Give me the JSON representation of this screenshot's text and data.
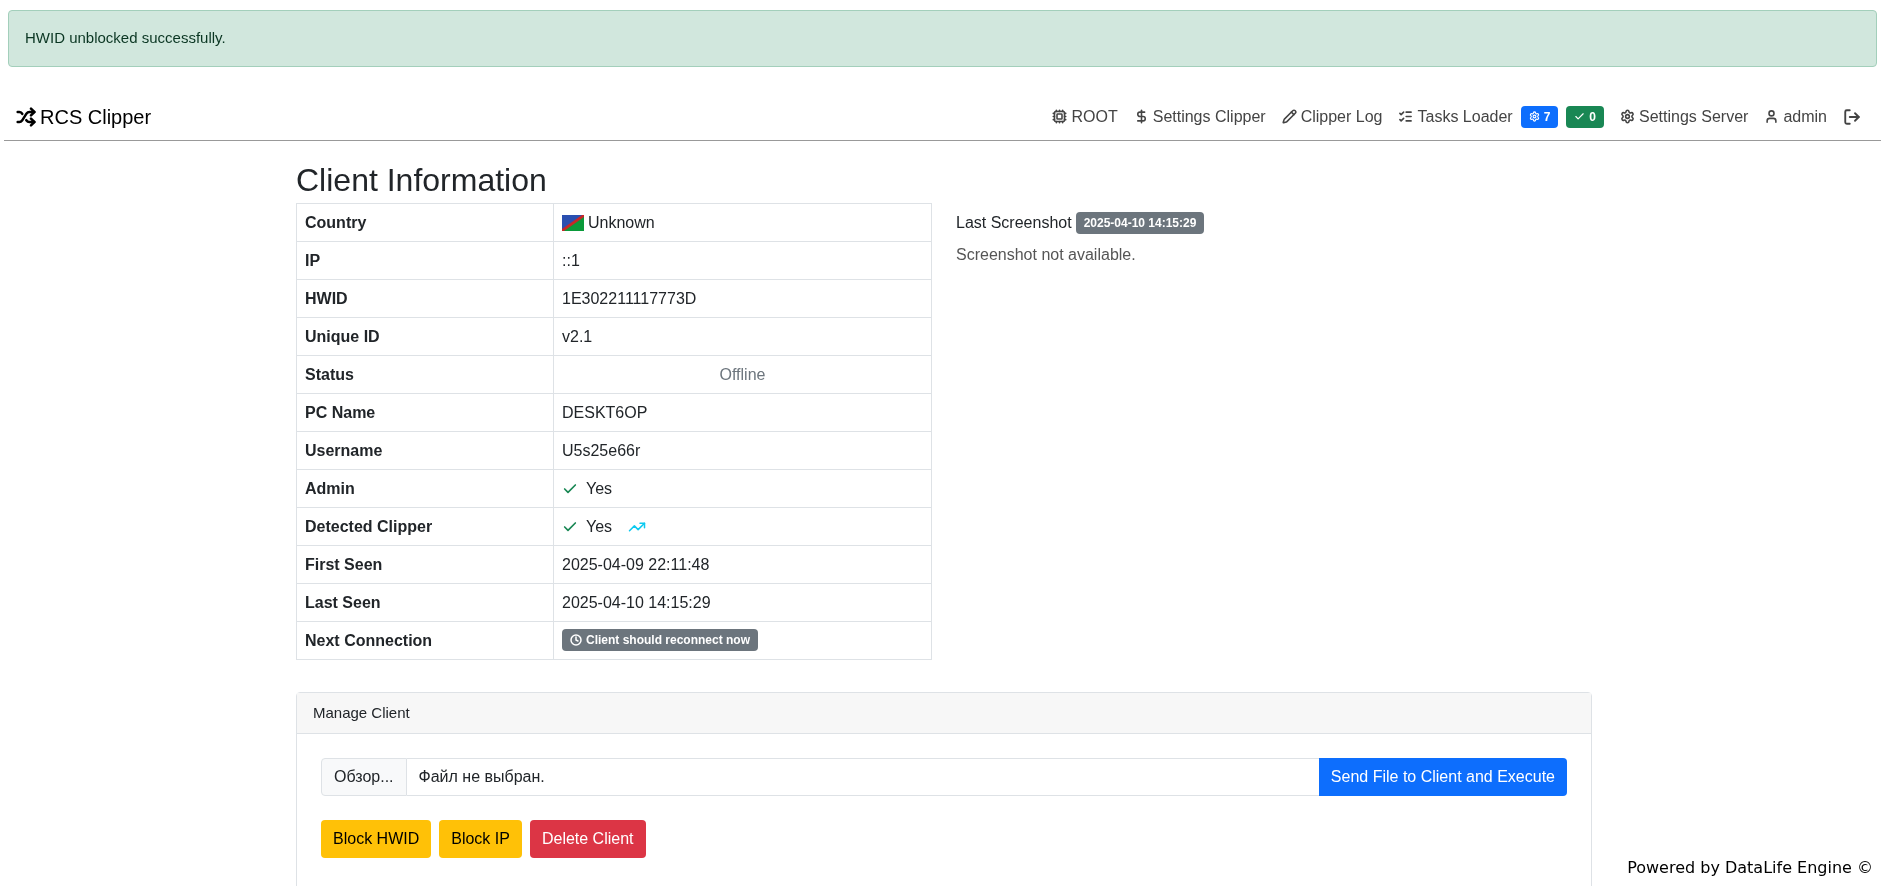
{
  "alert": {
    "message": "HWID unblocked successfully."
  },
  "navbar": {
    "brand": "RCS Clipper",
    "items": [
      {
        "label": "ROOT"
      },
      {
        "label": "Settings Clipper"
      },
      {
        "label": "Clipper Log"
      },
      {
        "label": "Tasks Loader",
        "badges": [
          {
            "text": "7",
            "color": "#0d6efd"
          },
          {
            "text": "0",
            "color": "#198754"
          }
        ]
      },
      {
        "label": "Settings Server"
      },
      {
        "label": "admin"
      }
    ]
  },
  "page_title": "Client Information",
  "info_table": [
    {
      "label": "Country",
      "kind": "flag",
      "value": "Unknown"
    },
    {
      "label": "IP",
      "kind": "text",
      "value": "::1"
    },
    {
      "label": "HWID",
      "kind": "text",
      "value": "1E302211117773D"
    },
    {
      "label": "Unique ID",
      "kind": "text",
      "value": "v2.1"
    },
    {
      "label": "Status",
      "kind": "status",
      "value": "Offline"
    },
    {
      "label": "PC Name",
      "kind": "text",
      "value": "DESKT6OP"
    },
    {
      "label": "Username",
      "kind": "text",
      "value": "U5s25e66r"
    },
    {
      "label": "Admin",
      "kind": "check",
      "value": "Yes"
    },
    {
      "label": "Detected Clipper",
      "kind": "check_chart",
      "value": "Yes"
    },
    {
      "label": "First Seen",
      "kind": "text",
      "value": "2025-04-09 22:11:48"
    },
    {
      "label": "Last Seen",
      "kind": "text",
      "value": "2025-04-10 14:15:29"
    },
    {
      "label": "Next Connection",
      "kind": "badge",
      "value": "Client should reconnect now"
    }
  ],
  "screenshot": {
    "label": "Last Screenshot",
    "timestamp": "2025-04-10 14:15:29",
    "message": "Screenshot not available."
  },
  "manage": {
    "title": "Manage Client",
    "browse_button": "Обзор...",
    "file_status": "Файл не выбран.",
    "send_button": "Send File to Client and Execute",
    "actions": [
      {
        "label": "Block HWID",
        "kind": "warning"
      },
      {
        "label": "Block IP",
        "kind": "warning"
      },
      {
        "label": "Delete Client",
        "kind": "danger"
      }
    ]
  },
  "footer": "Powered by DataLife Engine ©"
}
